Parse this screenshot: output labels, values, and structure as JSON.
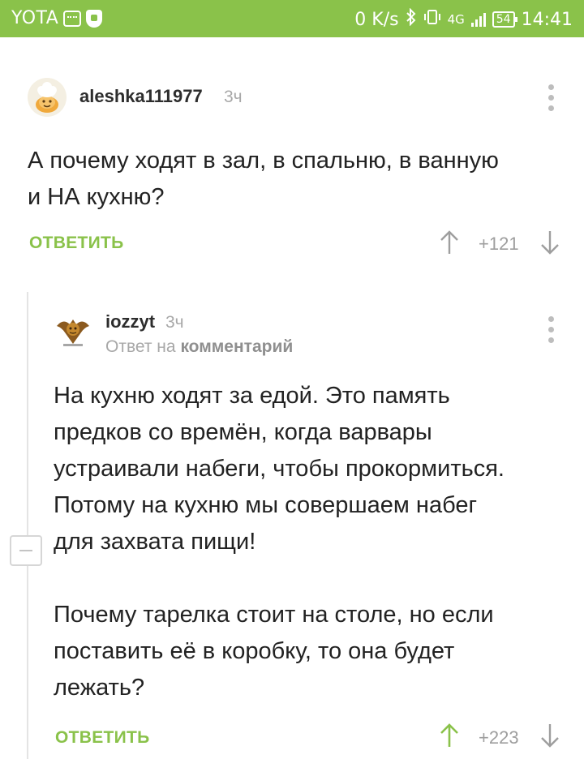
{
  "status_bar": {
    "carrier": "YOTA",
    "speed": "0 K/s",
    "network": "4G",
    "battery": "54",
    "time": "14:41"
  },
  "comments": [
    {
      "username": "aleshka111977",
      "time": "3ч",
      "text_lines": [
        "А почему ходят в зал, в спальню, в ванную",
        "и НА кухню?"
      ],
      "reply_label": "ОТВЕТИТЬ",
      "score": "+121"
    },
    {
      "username": "iozzyt",
      "time": "3ч",
      "reply_to_prefix": "Ответ на",
      "reply_to_link": "комментарий",
      "text_lines": [
        "На кухню ходят за едой. Это память",
        "предков со времён, когда варвары",
        "устраивали набеги, чтобы прокормиться.",
        "Потому на кухню мы совершаем набег",
        "для захвата пищи!",
        "",
        "Почему тарелка стоит на столе, но если",
        "поставить её в коробку, то она будет",
        "лежать?"
      ],
      "reply_label": "ОТВЕТИТЬ",
      "score": "+223"
    }
  ],
  "colors": {
    "accent": "#8ac24a",
    "upvoted": "#8ac24a",
    "neutral_icon": "#9e9e9e"
  },
  "icons": {
    "upvote": "arrow-up-icon",
    "downvote": "arrow-down-icon",
    "more": "kebab-menu-icon",
    "collapse": "collapse-thread-icon"
  }
}
